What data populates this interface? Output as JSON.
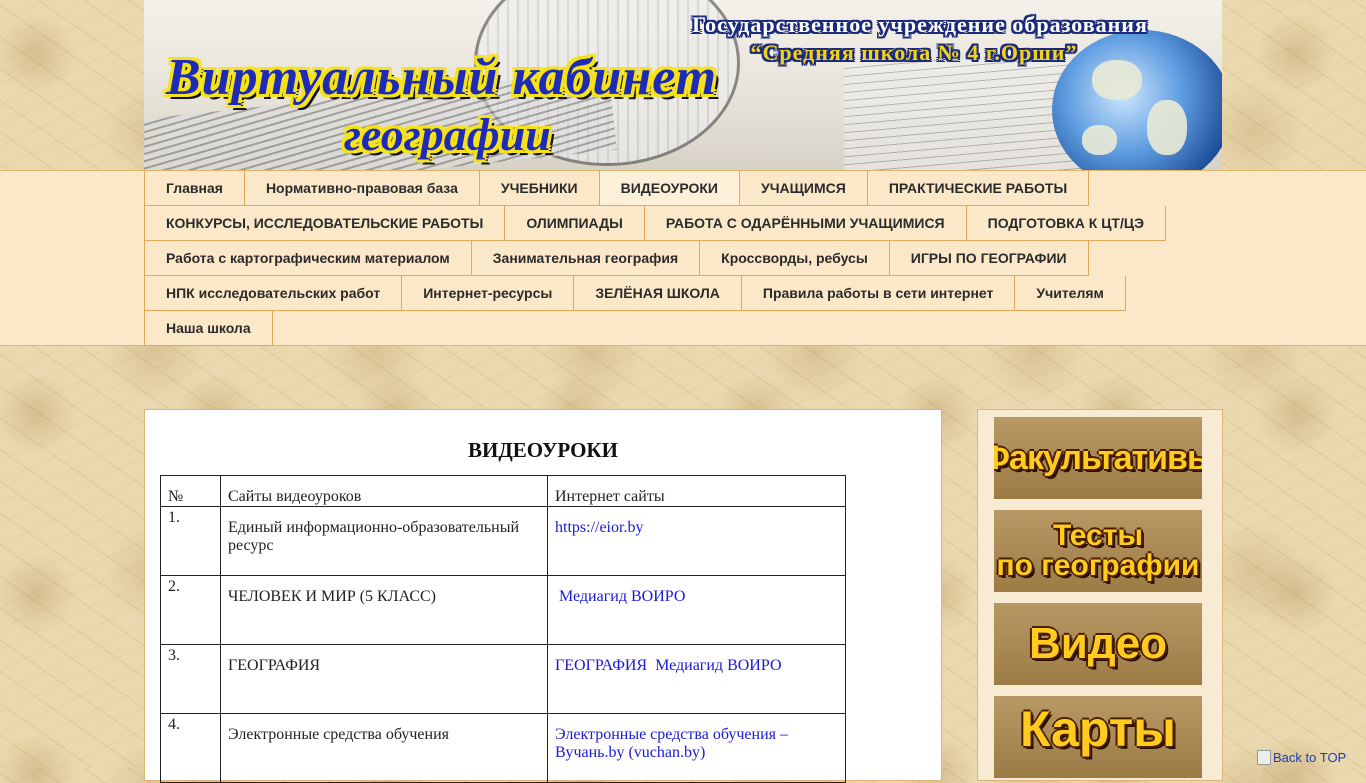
{
  "banner": {
    "line1": "Государственное учреждение образования",
    "line2": "“Средняя школа № 4 г.Орши”",
    "title_line1": "Виртуальный кабинет",
    "title_line2": "географии"
  },
  "nav": {
    "rows": [
      [
        "Главная",
        "Нормативно-правовая база",
        "УЧЕБНИКИ",
        "ВИДЕОУРОКИ",
        "УЧАЩИМСЯ",
        "ПРАКТИЧЕСКИЕ РАБОТЫ"
      ],
      [
        "КОНКУРСЫ, ИССЛЕДОВАТЕЛЬСКИЕ РАБОТЫ",
        "ОЛИМПИАДЫ",
        "РАБОТА С ОДАРЁННЫМИ УЧАЩИМИСЯ",
        "ПОДГОТОВКА К ЦТ/ЦЭ"
      ],
      [
        "Работа с картографическим материалом",
        "Занимательная география",
        "Кроссворды, ребусы",
        "ИГРЫ ПО ГЕОГРАФИИ"
      ],
      [
        "НПК исследовательских работ",
        "Интернет-ресурсы",
        "ЗЕЛЁНАЯ ШКОЛА",
        "Правила работы в сети интернет",
        "Учителям"
      ],
      [
        "Наша школа"
      ]
    ],
    "active": "ВИДЕОУРОКИ"
  },
  "content": {
    "title": "ВИДЕОУРОКИ",
    "table": {
      "headers": [
        "№",
        "Сайты видеоуроков",
        "Интернет сайты"
      ],
      "rows": [
        {
          "num": "1.",
          "site": "Единый информационно-образовательный ресурс",
          "link": "https://eior.by"
        },
        {
          "num": "2.",
          "site": "ЧЕЛОВЕК И МИР (5 КЛАСС)",
          "link": " Медиагид ВОИРО"
        },
        {
          "num": "3.",
          "site": "ГЕОГРАФИЯ",
          "link": "ГЕОГРАФИЯ  Медиагид ВОИРО"
        },
        {
          "num": "4.",
          "site": "Электронные средства обучения",
          "link": "Электронные средства обучения – Вучань.by (vuchan.by)"
        }
      ]
    }
  },
  "sidebar": {
    "buttons": [
      {
        "label": "Факультативы"
      },
      {
        "label_top": "Тесты",
        "label_bottom": "по географии"
      },
      {
        "label": "Видео"
      },
      {
        "label": "Карты"
      }
    ]
  },
  "back_to_top": "Back to TOP"
}
